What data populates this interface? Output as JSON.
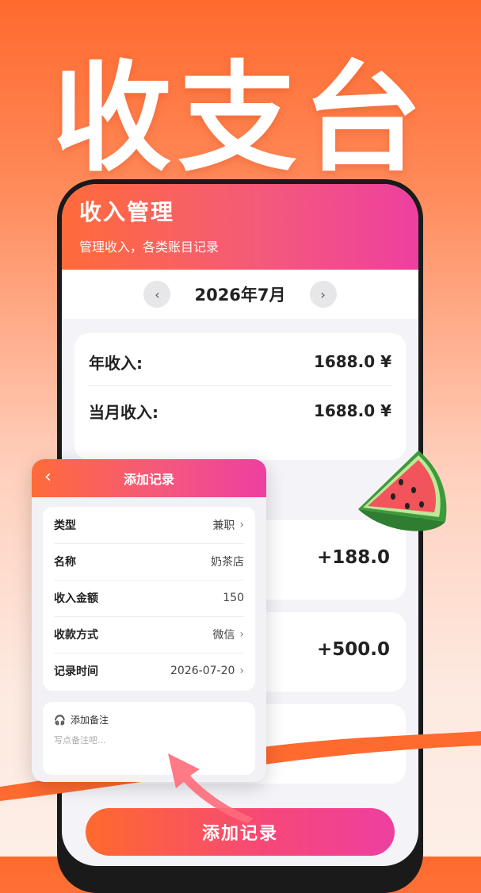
{
  "hero_title": "收支台账",
  "screen": {
    "title": "收入管理",
    "subtitle": "管理收入，各类账目记录",
    "month": "2026年7月",
    "summary": [
      {
        "label": "年收入:",
        "value": "1688.0 ¥"
      },
      {
        "label": "当月收入:",
        "value": "1688.0 ¥"
      }
    ],
    "records": [
      {
        "amount": "+188.0"
      },
      {
        "amount": "+500.0"
      },
      {
        "amount": ""
      }
    ],
    "add_button": "添加记录"
  },
  "dialog": {
    "title": "添加记录",
    "fields": [
      {
        "label": "类型",
        "value": "兼职",
        "chevron": true
      },
      {
        "label": "名称",
        "value": "奶茶店",
        "chevron": false
      },
      {
        "label": "收入金额",
        "value": "150",
        "chevron": false
      },
      {
        "label": "收款方式",
        "value": "微信",
        "chevron": true
      },
      {
        "label": "记录时间",
        "value": "2026-07-20",
        "chevron": true
      }
    ],
    "note_title": "添加备注",
    "note_placeholder": "写点备注吧..."
  },
  "colors": {
    "accent_orange": "#ff6a2e",
    "accent_pink": "#ee3fa0"
  }
}
